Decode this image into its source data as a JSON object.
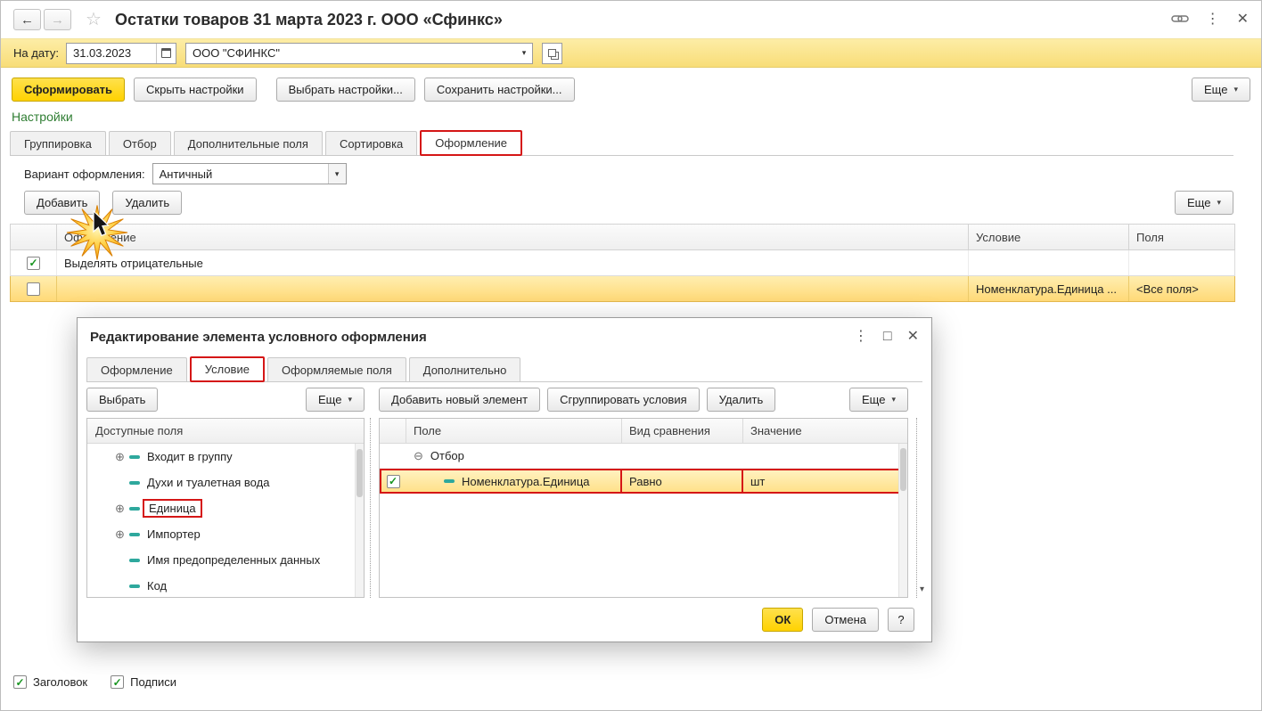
{
  "colors": {
    "accent_yellow": "#ffd200",
    "selection_yellow": "#ffe9a8",
    "annotation_red": "#d51616",
    "section_green": "#2e7d32",
    "filter_bar_yellow": "#f9e18a"
  },
  "icons": {
    "back": "←",
    "forward": "→",
    "favorite": "☆",
    "menu": "⋮",
    "close": "✕",
    "maximize": "□",
    "dropdown": "▾",
    "check": "✓",
    "expand": "⊕",
    "collapse": "⊖"
  },
  "window": {
    "title": "Остатки товаров 31 марта 2023 г. ООО «Сфинкс»"
  },
  "filter": {
    "date_label": "На дату:",
    "date_value": "31.03.2023",
    "org_value": "ООО \"СФИНКС\""
  },
  "actions": {
    "generate": "Сформировать",
    "hide_settings": "Скрыть настройки",
    "choose_settings": "Выбрать настройки...",
    "save_settings": "Сохранить настройки...",
    "more": "Еще"
  },
  "settings": {
    "header": "Настройки",
    "tabs": [
      "Группировка",
      "Отбор",
      "Дополнительные поля",
      "Сортировка",
      "Оформление"
    ],
    "variant_label": "Вариант оформления:",
    "variant_value": "Античный",
    "add": "Добавить",
    "delete": "Удалить",
    "more": "Еще",
    "table": {
      "columns": [
        "Оформление",
        "Условие",
        "Поля"
      ],
      "rows": [
        {
          "checked": true,
          "formatting": "Выделять отрицательные",
          "condition": "",
          "fields": ""
        },
        {
          "checked": false,
          "formatting": "",
          "condition": "Номенклатура.Единица ...",
          "fields": "<Все поля>"
        }
      ]
    }
  },
  "dialog": {
    "title": "Редактирование элемента условного оформления",
    "tabs": [
      "Оформление",
      "Условие",
      "Оформляемые поля",
      "Дополнительно"
    ],
    "left": {
      "select": "Выбрать",
      "more": "Еще",
      "header": "Доступные поля",
      "items": [
        {
          "label": "Входит в группу",
          "expandable": true
        },
        {
          "label": "Духи и туалетная вода",
          "expandable": false
        },
        {
          "label": "Единица",
          "expandable": true
        },
        {
          "label": "Импортер",
          "expandable": true
        },
        {
          "label": "Имя предопределенных данных",
          "expandable": false
        },
        {
          "label": "Код",
          "expandable": false
        }
      ]
    },
    "right": {
      "add_new": "Добавить новый элемент",
      "group_conditions": "Сгруппировать условия",
      "delete": "Удалить",
      "more": "Еще",
      "columns": [
        "Поле",
        "Вид сравнения",
        "Значение"
      ],
      "group_row": "Отбор",
      "condition": {
        "field": "Номенклатура.Единица",
        "comparison": "Равно",
        "value": "шт"
      }
    },
    "footer": {
      "ok": "ОК",
      "cancel": "Отмена",
      "help": "?"
    }
  },
  "footer": {
    "header_checkbox": "Заголовок",
    "captions_checkbox": "Подписи"
  }
}
